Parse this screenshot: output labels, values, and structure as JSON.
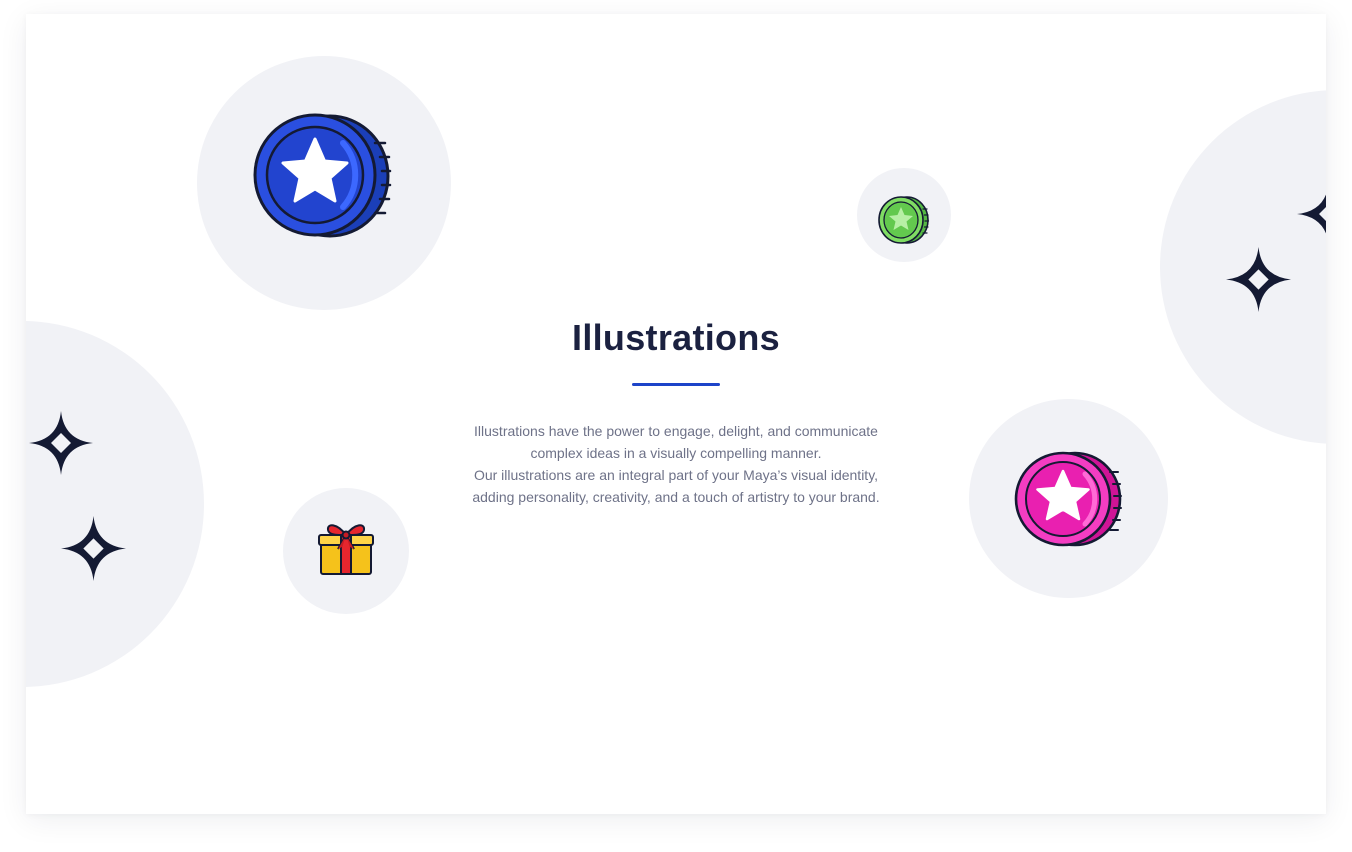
{
  "section": {
    "title": "Illustrations",
    "description_lines": [
      "Illustrations have the power to engage, delight, and communicate",
      "complex ideas in a visually compelling manner.",
      "Our illustrations are an integral part of your Maya’s  visual identity,",
      "adding personality, creativity, and a touch of artistry to your brand."
    ]
  },
  "illustrations": [
    {
      "icon": "blue-star-coin-icon",
      "color": "#2346d6"
    },
    {
      "icon": "green-star-coin-icon",
      "color": "#6fd15a"
    },
    {
      "icon": "pink-star-coin-icon",
      "color": "#f21fb3"
    },
    {
      "icon": "gift-box-icon",
      "color": "#f5c21b"
    },
    {
      "icon": "sparkle-icon",
      "color": "#141a33"
    }
  ],
  "colors": {
    "accent": "#1d44c9",
    "title": "#1b2140",
    "body_text": "#6e7288",
    "blob": "#f1f2f6",
    "outline": "#141a33"
  }
}
